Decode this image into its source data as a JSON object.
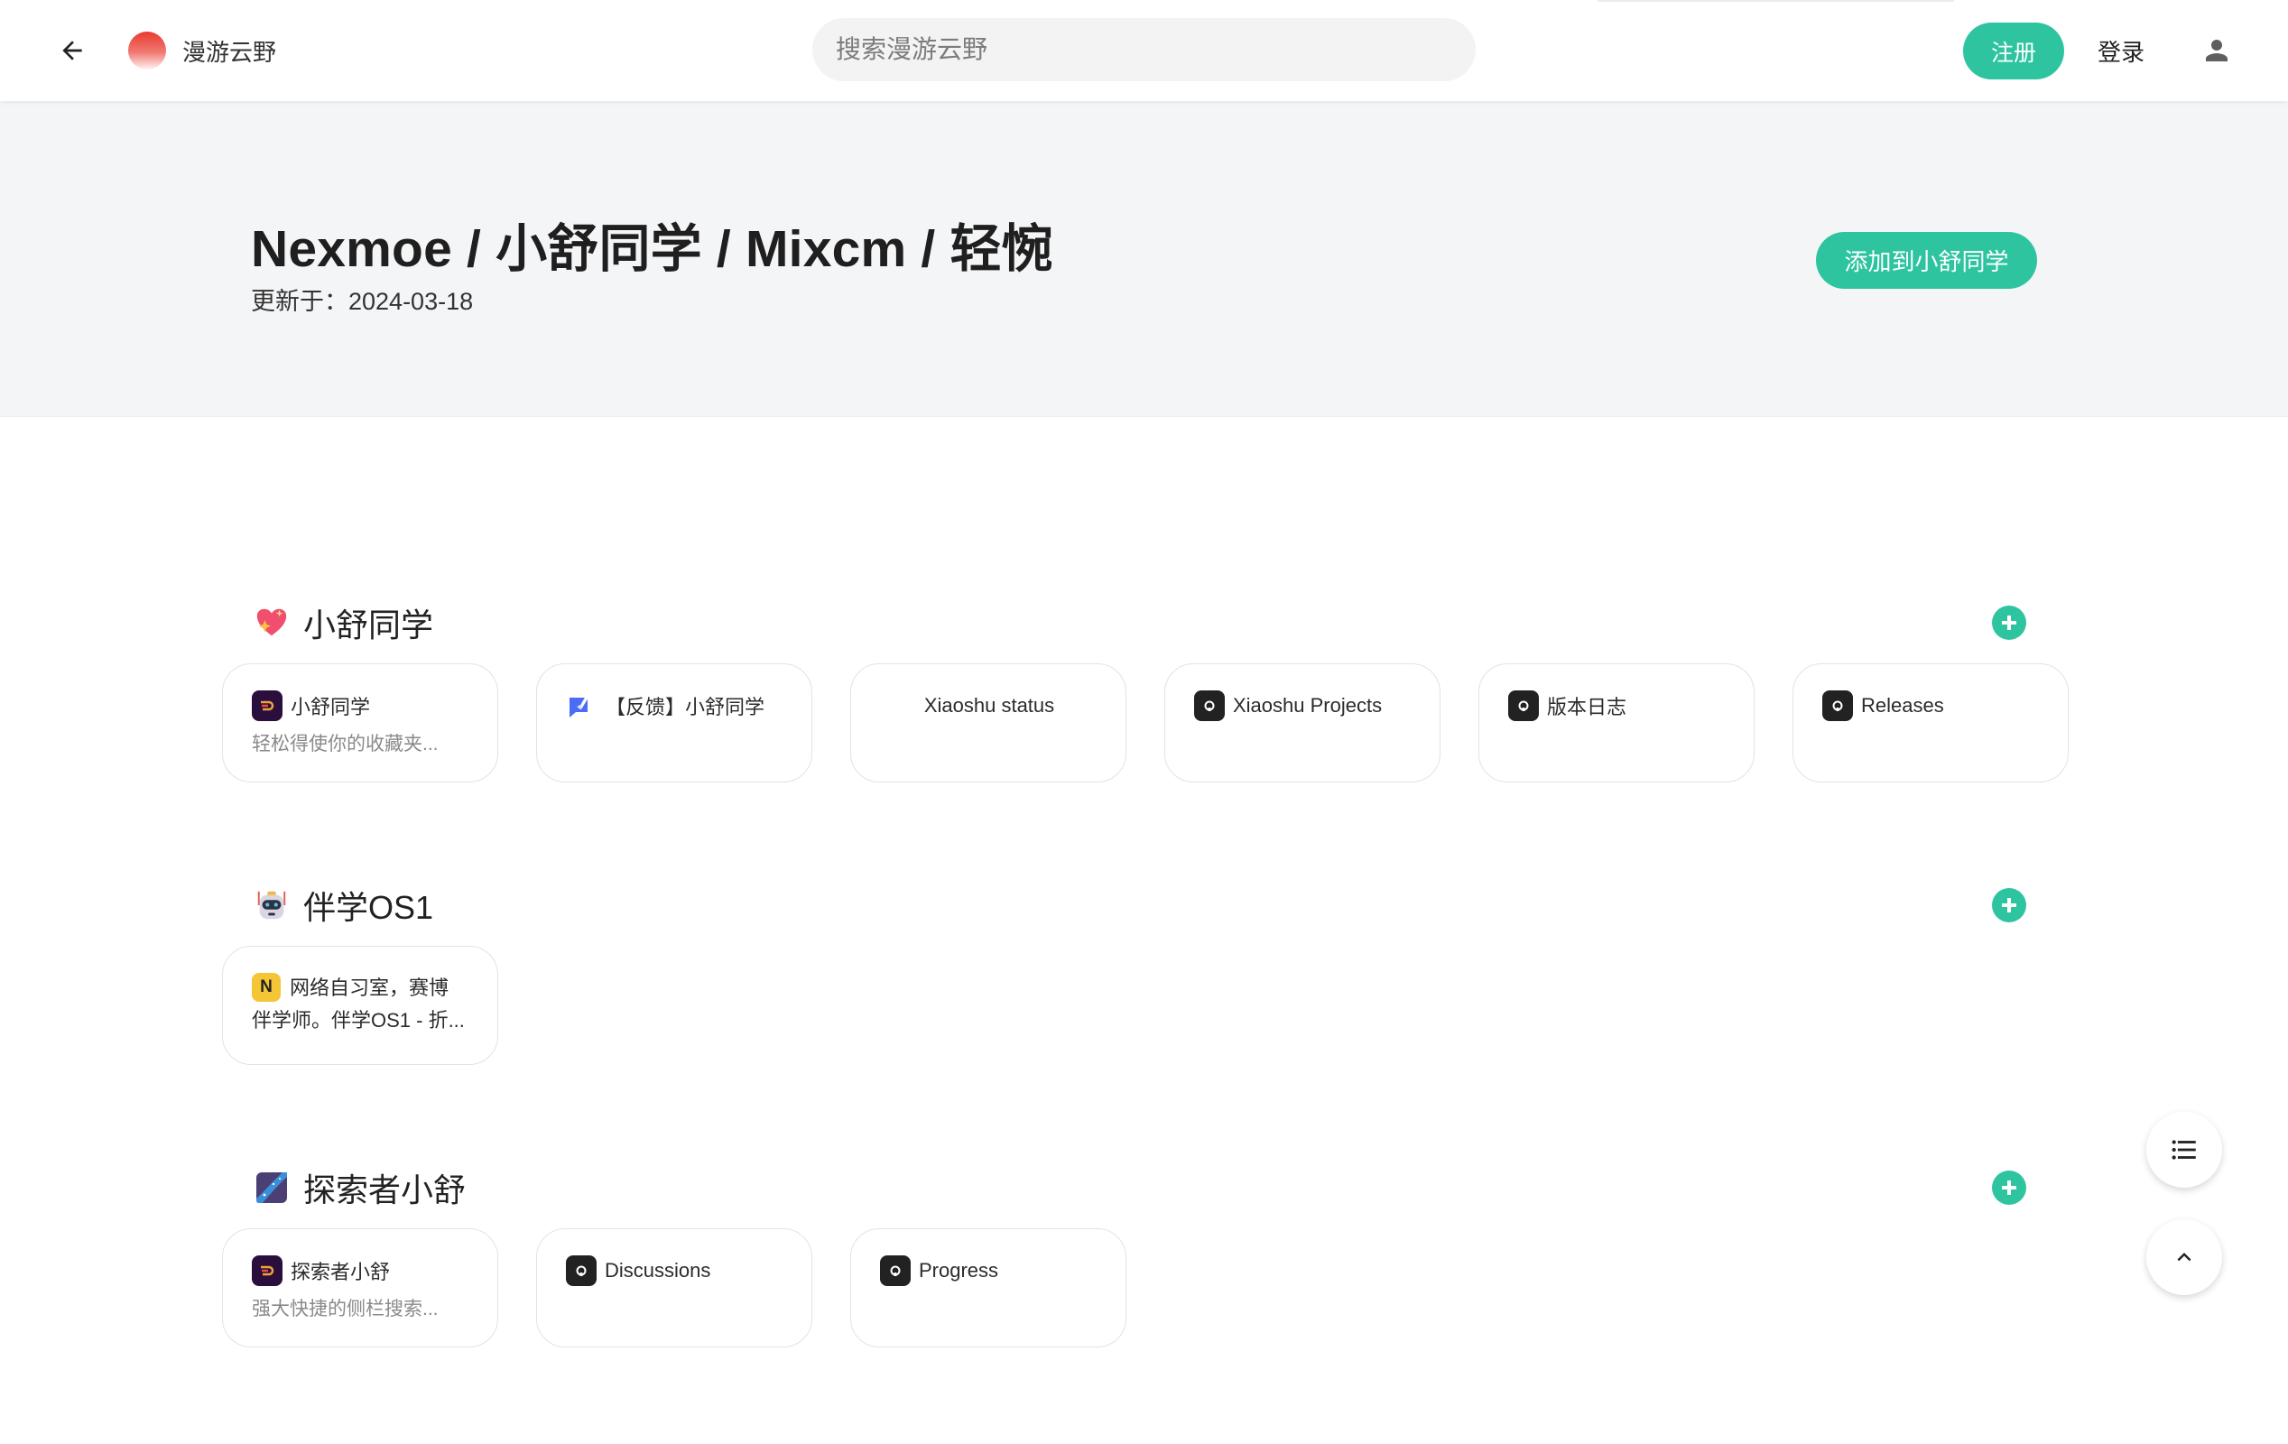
{
  "navbar": {
    "back_icon": "arrow-left-icon",
    "brand_name": "漫游云野",
    "search_placeholder": "搜索漫游云野",
    "register_label": "注册",
    "login_label": "登录",
    "user_icon": "person-icon"
  },
  "hero": {
    "title": "Nexmoe / 小舒同学 / Mixcm / 轻惋",
    "updated": "更新于：2024-03-18",
    "add_button_label": "添加到小舒同学"
  },
  "colors": {
    "accent": "#2ec4a0",
    "hero_bg": "#f4f5f7"
  },
  "sections": [
    {
      "title": "小舒同学",
      "icon": "sparkling-heart-icon",
      "cards": [
        {
          "title": "小舒同学",
          "description": "轻松得使你的收藏夹...",
          "icon": "xiaoshu-logo-icon"
        },
        {
          "title": "【反馈】小舒同学",
          "description": "",
          "icon": "feedback-rabbit-icon"
        },
        {
          "title": "Xiaoshu status",
          "description": "",
          "icon": ""
        },
        {
          "title": "Xiaoshu Projects",
          "description": "",
          "icon": "github-icon"
        },
        {
          "title": "版本日志",
          "description": "",
          "icon": "github-icon"
        },
        {
          "title": "Releases",
          "description": "",
          "icon": "github-icon"
        }
      ]
    },
    {
      "title": "伴学OS1",
      "icon": "robot-icon",
      "cards": [
        {
          "title": "网络自习室，赛博",
          "title_line2": "伴学师。伴学OS1 - 折...",
          "icon": "notion-icon",
          "icon_letter": "N"
        }
      ]
    },
    {
      "title": "探索者小舒",
      "icon": "explorer-app-icon",
      "cards": [
        {
          "title": "探索者小舒",
          "description": "强大快捷的侧栏搜索...",
          "icon": "xiaoshu-logo-icon"
        },
        {
          "title": "Discussions",
          "description": "",
          "icon": "github-icon"
        },
        {
          "title": "Progress",
          "description": "",
          "icon": "github-icon"
        }
      ]
    }
  ],
  "floating": {
    "toc_icon": "list-icon",
    "top_icon": "chevron-up-icon"
  }
}
